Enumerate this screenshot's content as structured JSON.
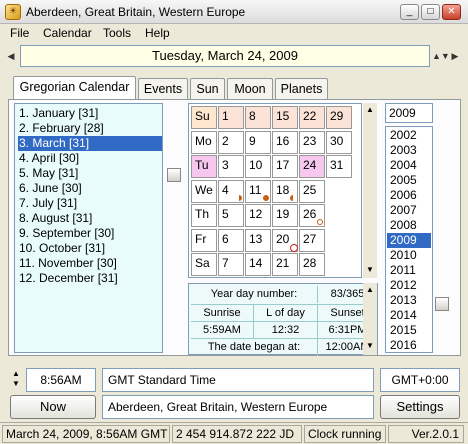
{
  "window": {
    "title": "Aberdeen, Great Britain, Western Europe",
    "min": "_",
    "max": "□",
    "close": "✕"
  },
  "menu": [
    "File",
    "Calendar",
    "Tools",
    "Help"
  ],
  "date_header": {
    "text": "Tuesday, March 24, 2009",
    "prev": "◀",
    "next": "▶"
  },
  "tabs": [
    "Gregorian Calendar",
    "Events",
    "Sun",
    "Moon",
    "Planets"
  ],
  "months": [
    "1. January [31]",
    "2. February [28]",
    "3. March [31]",
    "4. April [30]",
    "5. May [31]",
    "6. June [30]",
    "7. July [31]",
    "8. August [31]",
    "9. September [30]",
    "10. October [31]",
    "11. November [30]",
    "12. December [31]"
  ],
  "calendar": {
    "weekdays": [
      "Su",
      "Mo",
      "Tu",
      "We",
      "Th",
      "Fr",
      "Sa"
    ],
    "rows": [
      [
        "1",
        "8",
        "15",
        "22",
        "29"
      ],
      [
        "2",
        "9",
        "16",
        "23",
        "30"
      ],
      [
        "3",
        "10",
        "17",
        "24",
        "31"
      ],
      [
        "4",
        "11",
        "18",
        "25",
        ""
      ],
      [
        "5",
        "12",
        "19",
        "26",
        ""
      ],
      [
        "6",
        "13",
        "20",
        "27",
        ""
      ],
      [
        "7",
        "14",
        "21",
        "28",
        ""
      ]
    ],
    "colors": {
      "weekend": "#fbe3d8",
      "sunday": "#fde7cf",
      "today": "#f6c8f0",
      "moon": "#c86010"
    }
  },
  "info": {
    "year_day_label": "Year day number:",
    "year_day_value": "83/365",
    "sunrise_label": "Sunrise",
    "lod_label": "L of day",
    "sunset_label": "Sunset",
    "sunrise": "5:59AM",
    "lod": "12:32",
    "sunset": "6:31PM",
    "began_label": "The date began at:",
    "began": "12:00AM"
  },
  "year": {
    "current": "2009",
    "list": [
      "2002",
      "2003",
      "2004",
      "2005",
      "2006",
      "2007",
      "2008",
      "2009",
      "2010",
      "2011",
      "2012",
      "2013",
      "2014",
      "2015",
      "2016"
    ]
  },
  "bottom": {
    "time": "8:56AM",
    "timezone": "GMT Standard Time",
    "offset": "GMT+0:00",
    "now_button": "Now",
    "location": "Aberdeen, Great Britain, Western Europe",
    "settings_button": "Settings"
  },
  "status": {
    "datetime": "March 24, 2009, 8:56AM GMT",
    "jd": "2 454 914.872 222 JD",
    "clock": "Clock running",
    "version": "Ver.2.0.1"
  }
}
